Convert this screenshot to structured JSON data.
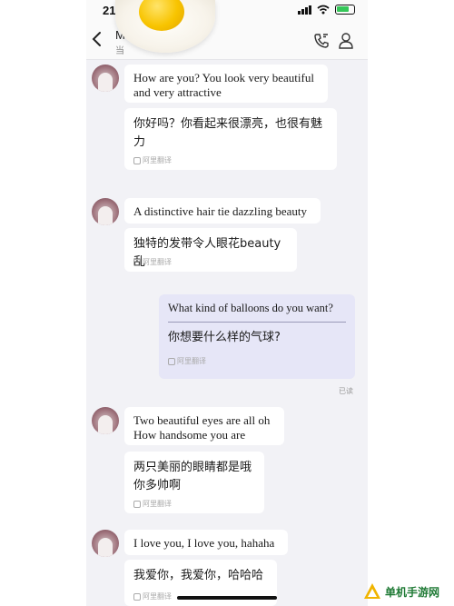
{
  "status_bar": {
    "time": "21",
    "battery_color": "#35c759"
  },
  "header": {
    "contact_name": "M          ed",
    "contact_status": "当"
  },
  "messages": [
    {
      "original": "How are you? You look very beautiful and very attractive",
      "translation": "你好吗？你看起来很漂亮，也很有魅力",
      "badge": "阿里翻译"
    },
    {
      "original": "A distinctive hair tie dazzling beauty",
      "translation": "独特的发带令人眼花beauty乱",
      "badge": "阿里翻译"
    },
    {
      "original": "What kind of balloons do you want?",
      "translation": "你想要什么样的气球?",
      "badge": "阿里翻译",
      "receipt": "已读"
    },
    {
      "original": "Two beautiful eyes are all oh How handsome you are",
      "translation": "两只美丽的眼睛都是哦你多帅啊",
      "badge": "阿里翻译"
    },
    {
      "original": "I love you, I love you, hahaha",
      "translation": "我爱你，我爱你，哈哈哈",
      "badge": "阿里翻译"
    }
  ],
  "watermark": {
    "text": "单机手游网",
    "color": "#1f7a35"
  },
  "colors": {
    "chat_background": "#f2f2f6",
    "outgoing_bubble": "#e6e6f7",
    "incoming_bubble": "#ffffff"
  }
}
